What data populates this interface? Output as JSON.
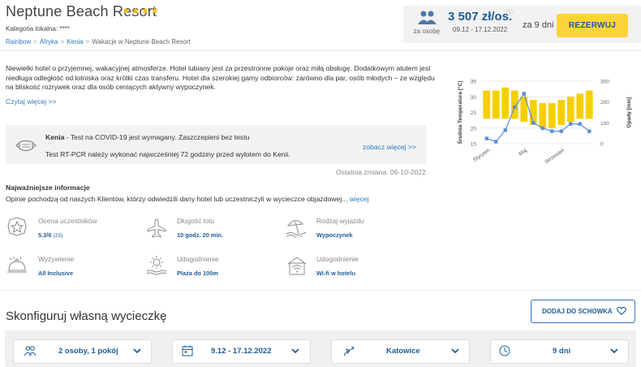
{
  "header": {
    "title": "Neptune Beach Resort",
    "stars": "★★★★",
    "local_category": "Kategoria lokalna: ****",
    "breadcrumb": [
      "Rainbow",
      "Afryka",
      "Kenia",
      "Wakacje w Neptune Beach Resort"
    ],
    "per_person": "za osobę",
    "price": "3 507 zł/os.",
    "price_info": "ⓘ",
    "price_dates": "09.12 - 17.12.2022",
    "nights": "za 9 dni",
    "reserve_button": "REZERWUJ"
  },
  "description": {
    "text": "Niewielki hotel o przyjemnej, wakacyjnej atmosferze. Hotel lubiany jest za przestronne pokoje oraz miłą obsługę. Dodatkowym atutem jest niedługa odległość od lotniska oraz krótki czas transferu. Hotel dla szerokiej gamy odbiorców: zarówno dla par, osób młodych – ze względu na bliskość rozrywek oraz dla osób ceniących aktywny wypoczynek.",
    "read_more": "Czytaj więcej >>"
  },
  "covid": {
    "country": "Kenia",
    "line1_rest": " - Test na COVID-19 jest wymagany. Zaszczepieni bez testu",
    "line2": "Test RT-PCR należy wykonać najwcześniej 72 godziny przed wylotem do Kenii.",
    "more_link": "zobacz więcej >>",
    "last_change": "Ostatnia zmiana: 06-10-2022"
  },
  "key_info": {
    "title": "Najważniejsze informacje",
    "subtitle": "Opinie pochodzą od naszych Klientów, którzy odwiedzili dany hotel lub uczestniczyli w wycieczce objazdowej...",
    "subtitle_link": "więcej",
    "items": [
      {
        "icon": "rating-icon",
        "label": "Ocena uczestników",
        "value": "5.3/6",
        "sub": "(23)"
      },
      {
        "icon": "plane-icon",
        "label": "Długość lotu",
        "value": "10 godz. 20 min.",
        "sub": ""
      },
      {
        "icon": "beach-icon",
        "label": "Rodzaj wyjazdu",
        "value": "Wypoczynek",
        "sub": ""
      },
      {
        "icon": "food-icon",
        "label": "Wyżywienie",
        "value": "All Inclusive",
        "sub": ""
      },
      {
        "icon": "sun-sea-icon",
        "label": "Udogodnienie",
        "value": "Plaża do 100m",
        "sub": ""
      },
      {
        "icon": "wifi-icon",
        "label": "Udogodnienie",
        "value": "Wi-fi w hotelu",
        "sub": ""
      }
    ]
  },
  "configurator": {
    "title": "Skonfiguruj własną wycieczkę",
    "add_to_basket": "DODAJ DO SCHOWKA",
    "selectors": [
      {
        "icon": "people-icon",
        "value": "2 osoby, 1 pokój"
      },
      {
        "icon": "calendar-icon",
        "value": "9.12 - 17.12.2022"
      },
      {
        "icon": "departure-plane-icon",
        "value": "Katowice"
      },
      {
        "icon": "clock-icon",
        "value": "9 dni"
      }
    ]
  },
  "colors": {
    "accent": "#1e5c96",
    "link": "#2a7ac0",
    "button_yellow": "#fbd33a",
    "temperature_bars": "#f5d000",
    "rain_line": "#5a8fd6"
  },
  "chart_data": {
    "type": "bar",
    "ylabel": "Średnia Temperatura [°C]",
    "y2label": "Opady [mm]",
    "ylim": [
      15,
      35
    ],
    "y2lim": [
      0,
      300
    ],
    "x_tick_labels": [
      "Styczeń",
      "Maj",
      "Wrzesień"
    ],
    "temperature_ranges": [
      [
        23,
        32
      ],
      [
        23,
        32
      ],
      [
        23,
        33
      ],
      [
        23,
        32
      ],
      [
        22,
        30
      ],
      [
        21,
        29
      ],
      [
        20,
        28
      ],
      [
        20,
        28
      ],
      [
        21,
        29
      ],
      [
        22,
        30
      ],
      [
        23,
        31
      ],
      [
        23,
        32
      ]
    ],
    "rainfall": [
      25,
      10,
      65,
      175,
      240,
      100,
      75,
      60,
      60,
      95,
      95,
      60
    ],
    "y_ticks": [
      15,
      20,
      25,
      30,
      35
    ],
    "y2_ticks": [
      0,
      100,
      200,
      300
    ],
    "grid": true
  }
}
